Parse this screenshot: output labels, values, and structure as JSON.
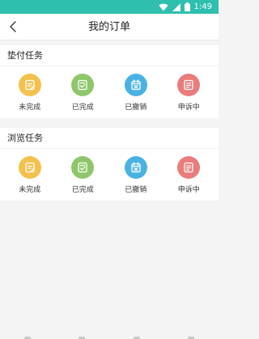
{
  "status_bar": {
    "time": "1:49",
    "bg_color": "#2ebfae",
    "icons": [
      "wifi-icon",
      "signal-icon",
      "battery-icon"
    ]
  },
  "app_bar": {
    "title": "我的订单",
    "back_icon": "chevron-left-icon"
  },
  "sections": [
    {
      "title": "垫付任务",
      "items": [
        {
          "label": "未完成",
          "icon": "pending-icon",
          "color": "#f2c14e"
        },
        {
          "label": "已完成",
          "icon": "completed-icon",
          "color": "#8fc66b"
        },
        {
          "label": "已撤销",
          "icon": "cancelled-icon",
          "color": "#4ab2e3"
        },
        {
          "label": "申诉中",
          "icon": "appeal-icon",
          "color": "#ea7c7c"
        }
      ]
    },
    {
      "title": "浏览任务",
      "items": [
        {
          "label": "未完成",
          "icon": "pending-icon",
          "color": "#f2c14e"
        },
        {
          "label": "已完成",
          "icon": "completed-icon",
          "color": "#8fc66b"
        },
        {
          "label": "已撤销",
          "icon": "cancelled-icon",
          "color": "#4ab2e3"
        },
        {
          "label": "申诉中",
          "icon": "appeal-icon",
          "color": "#ea7c7c"
        }
      ]
    }
  ]
}
